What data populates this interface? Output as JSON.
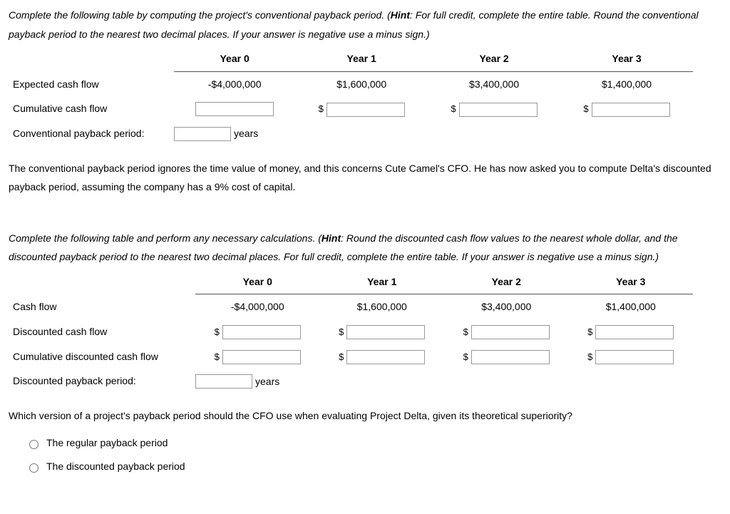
{
  "intro1": "Complete the following table by computing the project's conventional payback period. (",
  "intro1_bold": "Hint",
  "intro1_rest": ": For full credit, complete the entire table. Round the conventional payback period to the nearest two decimal places. If your answer is negative use a minus sign.)",
  "headers": {
    "y0": "Year 0",
    "y1": "Year 1",
    "y2": "Year 2",
    "y3": "Year 3"
  },
  "t1": {
    "row1_label": "Expected cash flow",
    "row1": {
      "y0": "-$4,000,000",
      "y1": "$1,600,000",
      "y2": "$3,400,000",
      "y3": "$1,400,000"
    },
    "row2_label": "Cumulative cash flow",
    "row3_label": "Conventional payback period:"
  },
  "dollar": "$",
  "years": "years",
  "para2": "The conventional payback period ignores the time value of money, and this concerns Cute Camel's CFO. He has now asked you to compute Delta's discounted payback period, assuming the company has a 9% cost of capital.",
  "intro3": "Complete the following table and perform any necessary calculations. (",
  "intro3_bold": "Hint",
  "intro3_rest": ": Round the discounted cash flow values to the nearest whole dollar, and the discounted payback period to the nearest two decimal places. For full credit, complete the entire table. If your answer is negative use a minus sign.)",
  "t2": {
    "row1_label": "Cash flow",
    "row1": {
      "y0": "-$4,000,000",
      "y1": "$1,600,000",
      "y2": "$3,400,000",
      "y3": "$1,400,000"
    },
    "row2_label": "Discounted cash flow",
    "row3_label": "Cumulative discounted cash flow",
    "row4_label": "Discounted payback period:"
  },
  "q": "Which version of a project's payback period should the CFO use when evaluating Project Delta, given its theoretical superiority?",
  "opt1": "The regular payback period",
  "opt2": "The discounted payback period",
  "chart_data": {
    "type": "table",
    "title": "Project Delta cash flows",
    "categories": [
      "Year 0",
      "Year 1",
      "Year 2",
      "Year 3"
    ],
    "series": [
      {
        "name": "Expected cash flow",
        "values": [
          -4000000,
          1600000,
          3400000,
          1400000
        ]
      },
      {
        "name": "Cash flow (discounted table)",
        "values": [
          -4000000,
          1600000,
          3400000,
          1400000
        ]
      }
    ],
    "cost_of_capital": 0.09
  }
}
